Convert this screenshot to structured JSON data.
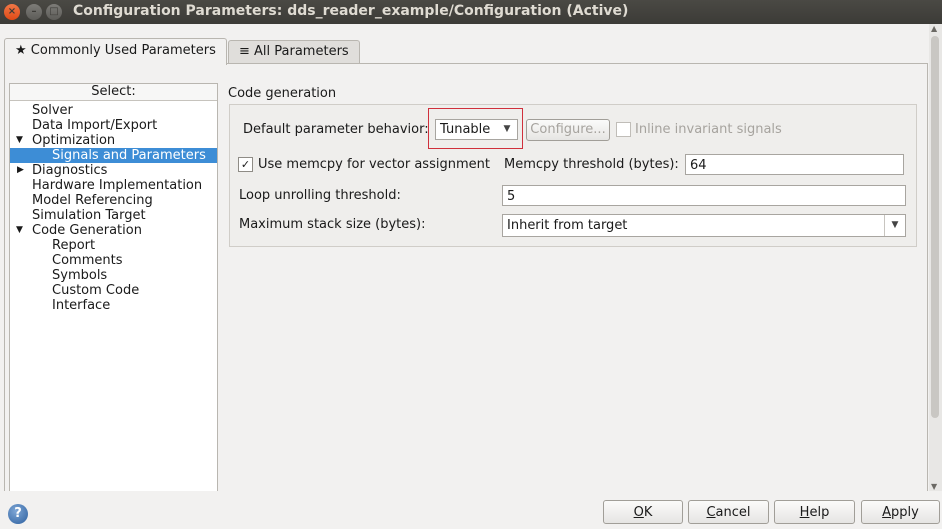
{
  "window": {
    "title": "Configuration Parameters: dds_reader_example/Configuration (Active)",
    "close_glyph": "×",
    "min_glyph": "–",
    "max_glyph": "□"
  },
  "tabs": [
    {
      "label": "★ Commonly Used Parameters",
      "active": true
    },
    {
      "label": "≡ All Parameters",
      "active": false
    }
  ],
  "tree": {
    "header": "Select:",
    "items": [
      {
        "label": "Solver",
        "level": 1
      },
      {
        "label": "Data Import/Export",
        "level": 1
      },
      {
        "label": "Optimization",
        "level": 1,
        "expanded": true
      },
      {
        "label": "Signals and Parameters",
        "level": 2,
        "selected": true
      },
      {
        "label": "Diagnostics",
        "level": 1,
        "collapsed": true
      },
      {
        "label": "Hardware Implementation",
        "level": 1
      },
      {
        "label": "Model Referencing",
        "level": 1
      },
      {
        "label": "Simulation Target",
        "level": 1
      },
      {
        "label": "Code Generation",
        "level": 1,
        "expanded": true
      },
      {
        "label": "Report",
        "level": 2
      },
      {
        "label": "Comments",
        "level": 2
      },
      {
        "label": "Symbols",
        "level": 2
      },
      {
        "label": "Custom Code",
        "level": 2
      },
      {
        "label": "Interface",
        "level": 2
      }
    ]
  },
  "panel": {
    "section_title": "Code generation",
    "default_param_label": "Default parameter behavior:",
    "default_param_value": "Tunable",
    "configure_label": "Configure...",
    "inline_invariant_label": "Inline invariant signals",
    "inline_invariant_checked": false,
    "memcpy_label": "Use memcpy for vector assignment",
    "memcpy_checked": true,
    "memcpy_threshold_label": "Memcpy threshold (bytes):",
    "memcpy_threshold_value": "64",
    "loop_unroll_label": "Loop unrolling threshold:",
    "loop_unroll_value": "5",
    "max_stack_label": "Maximum stack size (bytes):",
    "max_stack_value": "Inherit from target"
  },
  "buttons": {
    "help_icon": "?",
    "ok": {
      "mnemonic": "O",
      "rest": "K"
    },
    "cancel": {
      "mnemonic": "C",
      "rest": "ancel"
    },
    "help": {
      "mnemonic": "H",
      "rest": "elp"
    },
    "apply": {
      "mnemonic": "A",
      "rest": "pply"
    }
  },
  "colors": {
    "selection": "#3d8dd6",
    "highlight_box": "#d0303c",
    "titlebar": "#3c3b37"
  }
}
